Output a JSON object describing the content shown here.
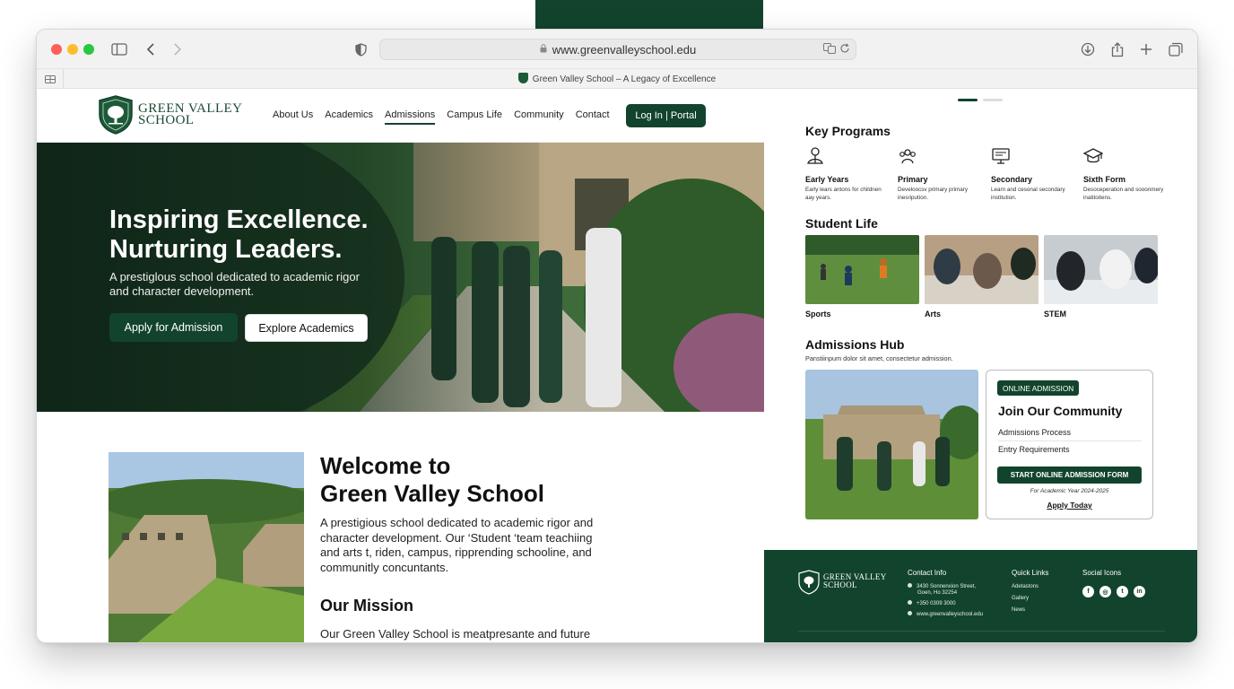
{
  "browser": {
    "url": "www.greenvalleyschool.edu",
    "tab_title": "Green Valley School – A Legacy of Excellence"
  },
  "site": {
    "logo_line1": "GREEN VALLEY",
    "logo_line2": "SCHOOL",
    "nav": [
      "About Us",
      "Academics",
      "Admissions",
      "Campus Life",
      "Community",
      "Contact"
    ],
    "nav_active": "Admissions",
    "login_label": "Log In | Portal"
  },
  "hero": {
    "title": "Inspiring Excellence.\nNurturing Leaders.",
    "subtitle": "A prestiglous school dedicated to academic rigor and character development.",
    "apply_label": "Apply for Admission",
    "explore_label": "Explore Academics"
  },
  "welcome": {
    "title": "Welcome to\nGreen Valley School",
    "body": "A prestigious school dedicated to academic rigor and character development. Our ‘Student ‘team teachiing and arts t, riden, campus, ripprending schooline, and communitly concuntants.",
    "mission_title": "Our Mission",
    "mission_body": "Our Green Valley School is meatpresante and future"
  },
  "key_programs": {
    "title": "Key Programs",
    "items": [
      {
        "name": "Early Years",
        "desc": "Early lears antons for childnen aay years.",
        "icon": "seedling-icon"
      },
      {
        "name": "Primary",
        "desc": "Develoocsv primary primary inesripution.",
        "icon": "group-icon"
      },
      {
        "name": "Secondary",
        "desc": "Learn and cesonal secondary institution.",
        "icon": "monitor-icon"
      },
      {
        "name": "Sixth Form",
        "desc": "Desoceperation and sooonmery inatitoitens.",
        "icon": "graduation-cap-icon"
      }
    ]
  },
  "student_life": {
    "title": "Student Life",
    "items": [
      "Sports",
      "Arts",
      "STEM"
    ]
  },
  "admissions": {
    "title": "Admissions Hub",
    "subtitle": "Panstiinpum dolor sit amet, consectetur admission.",
    "badge": "ONLINE ADMISSION",
    "card_title": "Join Our Community",
    "links": [
      "Admissions Process",
      "Entry Requirements"
    ],
    "form_button": "START ONLINE ADMISSION FORM",
    "year_note": "For Academic Year 2024-2025",
    "apply_today": "Apply Today"
  },
  "footer": {
    "logo_line1": "GREEN VALLEY",
    "logo_line2": "SCHOOL",
    "contact_title": "Contact Info",
    "contact_lines": [
      "3430 Sonnenxion Street,",
      "Goen, Ho 32254",
      "+350 0309 3000",
      "www.greenvalleyschool.edu"
    ],
    "quick_title": "Quick Links",
    "quick_links": [
      "Adetastons",
      "Gallery",
      "News"
    ],
    "social_title": "Social Icons",
    "social": [
      "facebook-icon",
      "instagram-icon",
      "twitter-icon",
      "linkedin-icon"
    ]
  },
  "colors": {
    "brand_green": "#12442d",
    "accent_red": "#fe5f57",
    "accent_yellow": "#febc2e",
    "accent_green": "#28c840"
  }
}
